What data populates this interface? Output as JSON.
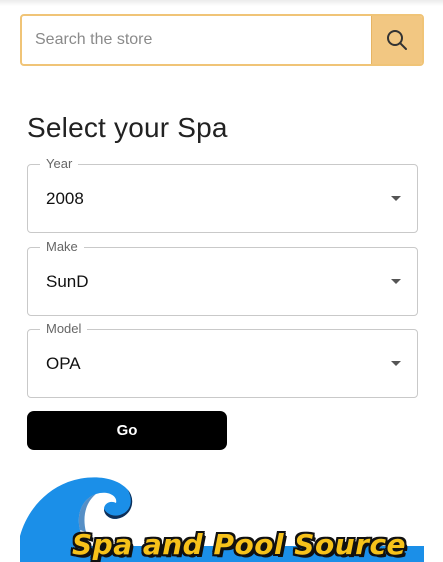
{
  "search": {
    "placeholder": "Search the store",
    "value": "",
    "icon": "search-icon"
  },
  "selector": {
    "title": "Select your Spa",
    "fields": [
      {
        "label": "Year",
        "value": "2008"
      },
      {
        "label": "Make",
        "value": "SunD"
      },
      {
        "label": "Model",
        "value": "OPA"
      }
    ],
    "go_label": "Go"
  },
  "logo": {
    "text": "Spa and Pool Source"
  },
  "colors": {
    "search_border": "#f0c477",
    "search_button": "#f2c782",
    "go_button": "#000000",
    "logo_wave": "#1b8fe8",
    "logo_text": "#f7c21a"
  }
}
